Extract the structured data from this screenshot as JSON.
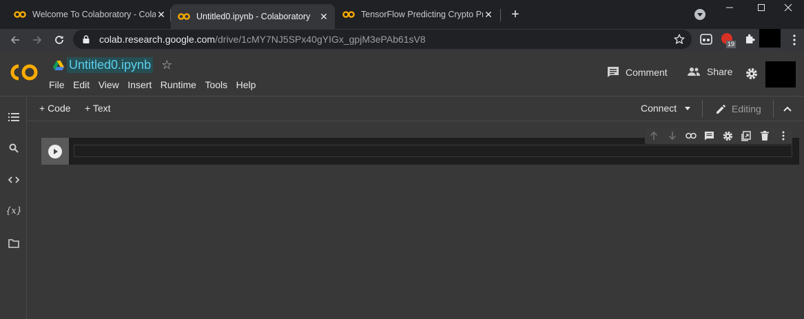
{
  "browser": {
    "tabs": [
      {
        "title": "Welcome To Colaboratory - Colab",
        "active": false
      },
      {
        "title": "Untitled0.ipynb - Colaboratory",
        "active": true
      },
      {
        "title": "TensorFlow Predicting Crypto Pri",
        "active": false
      }
    ],
    "new_tab_label": "+",
    "close_glyph": "✕",
    "url_host": "colab.research.google.com",
    "url_path": "/drive/1cMY7NJ5SPx40gYIGx_gpjM3ePAb61sV8",
    "extension_badge": "19"
  },
  "colab": {
    "logo_text": "CO",
    "notebook_title": "Untitled0.ipynb",
    "menu": [
      "File",
      "Edit",
      "View",
      "Insert",
      "Runtime",
      "Tools",
      "Help"
    ],
    "comment_label": "Comment",
    "share_label": "Share"
  },
  "toolbar": {
    "add_code_label": "+ Code",
    "add_text_label": "+ Text",
    "connect_label": "Connect",
    "editing_label": "Editing"
  },
  "sidebar": {
    "variables_label": "{x}"
  },
  "colors": {
    "accent_orange": "#f9ab00",
    "title_cyan": "#5cd0ef",
    "background": "#383838"
  }
}
